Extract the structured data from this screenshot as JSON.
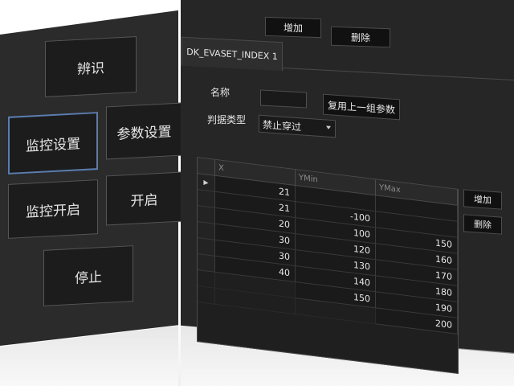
{
  "left": {
    "identify": "辨识",
    "monitor_settings": "监控设置",
    "param_settings": "参数设置",
    "monitor_open": "监控开启",
    "open": "开启",
    "stop": "停止"
  },
  "toolbar": {
    "add": "增加",
    "delete": "删除"
  },
  "tab": {
    "label": "DK_EVASET_INDEX 1"
  },
  "form": {
    "name_label": "名称",
    "name_value": "",
    "reuse_label": "复用上一组参数",
    "type_label": "判据类型",
    "type_value": "禁止穿过"
  },
  "grid": {
    "headers": [
      "X",
      "YMin",
      "YMax"
    ],
    "rows": [
      {
        "x": "21",
        "ymin": "",
        "ymax": ""
      },
      {
        "x": "21",
        "ymin": "-100",
        "ymax": ""
      },
      {
        "x": "20",
        "ymin": "100",
        "ymax": "150"
      },
      {
        "x": "30",
        "ymin": "120",
        "ymax": "160"
      },
      {
        "x": "30",
        "ymin": "130",
        "ymax": "170"
      },
      {
        "x": "40",
        "ymin": "140",
        "ymax": "180"
      },
      {
        "x": "",
        "ymin": "150",
        "ymax": "190"
      },
      {
        "x": "",
        "ymin": "",
        "ymax": "200"
      }
    ],
    "add": "增加",
    "delete": "删除"
  }
}
